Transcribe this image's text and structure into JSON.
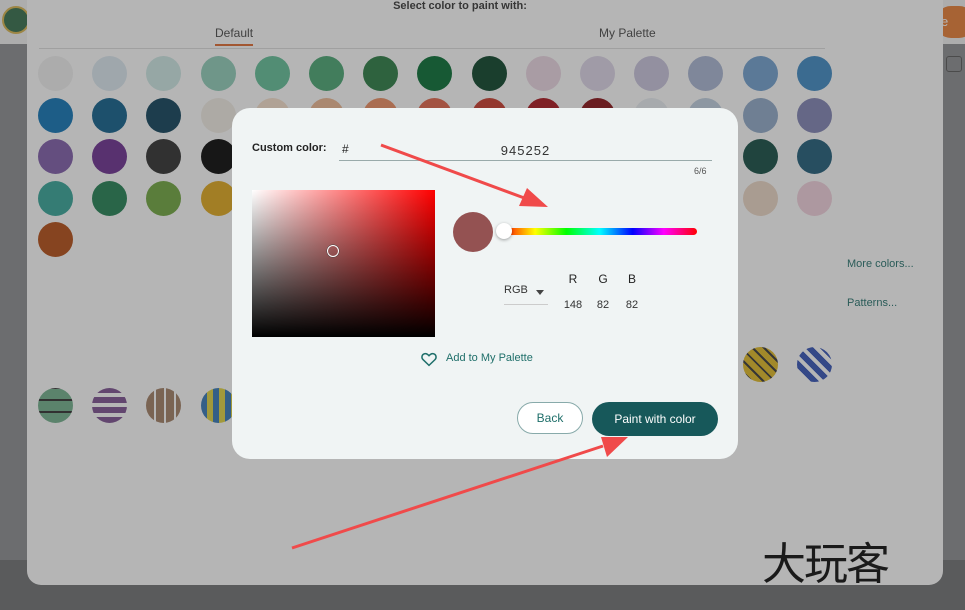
{
  "header": {
    "title": "Select color to paint with:",
    "orange_button": "e"
  },
  "tabs": [
    {
      "label": "Default"
    },
    {
      "label": "My Palette"
    }
  ],
  "side_links": {
    "more_colors": "More colors...",
    "patterns": "Patterns..."
  },
  "swatch_colors": [
    "#f0f0f0",
    "#dbe8f1",
    "#cde8e5",
    "#8fcdb9",
    "#5fbe96",
    "#46a570",
    "#267a40",
    "#006b2f",
    "#063f24",
    "#ecd7e4",
    "#ded6e9",
    "#c9c4de",
    "#a9b5d3",
    "#6f9fcf",
    "#3b88c4",
    "#0a71b5",
    "#0a5c8a",
    "#0a3e57",
    "#f2eee6",
    "#f7e1cc",
    "#eeb790",
    "#ed8c5e",
    "#e26246",
    "#c93628",
    "#a80f17",
    "#860a10",
    "#e8eef2",
    "#bfcfe0",
    "#8fa9c8",
    "#7f82b3",
    "#7d5aa8",
    "#6a2a8f",
    "#2b2b2b",
    "#000000",
    "#a01c36",
    "#c4524a",
    "#e69479",
    "#e7c4a9",
    "#f7f0b8",
    "#e5eef4",
    "#a9cfe2",
    "#6ca2cd",
    "#3b6ea8",
    "#0f4a40",
    "#1a5977",
    "#31a396",
    "#1e7f4f",
    "#6da53b",
    "#e0a618",
    "#e07b15",
    "#de67a7",
    "#7f7f7f",
    "#8fcdb9",
    "#f7f0b8",
    "#b5b5d8",
    "#e88580",
    "#f7c58e",
    "#f8f4c4",
    "#ecd7c6",
    "#f3d1dd",
    "#b34a0f"
  ],
  "modal": {
    "custom_color_label": "Custom color:",
    "hash": "#",
    "hex_value": "945252",
    "char_count": "6/6",
    "preview_color": "#945252",
    "color_mode": "RGB",
    "channels": [
      {
        "label": "R",
        "value": "148"
      },
      {
        "label": "G",
        "value": "82"
      },
      {
        "label": "B",
        "value": "82"
      }
    ],
    "add_to_palette": "Add to My Palette",
    "back_label": "Back",
    "paint_label": "Paint with color"
  },
  "accent_colors": {
    "primary": "#17585a",
    "tab_underline": "#e0682c",
    "annotation_arrow": "#f04a4a"
  },
  "watermark": "大玩客"
}
